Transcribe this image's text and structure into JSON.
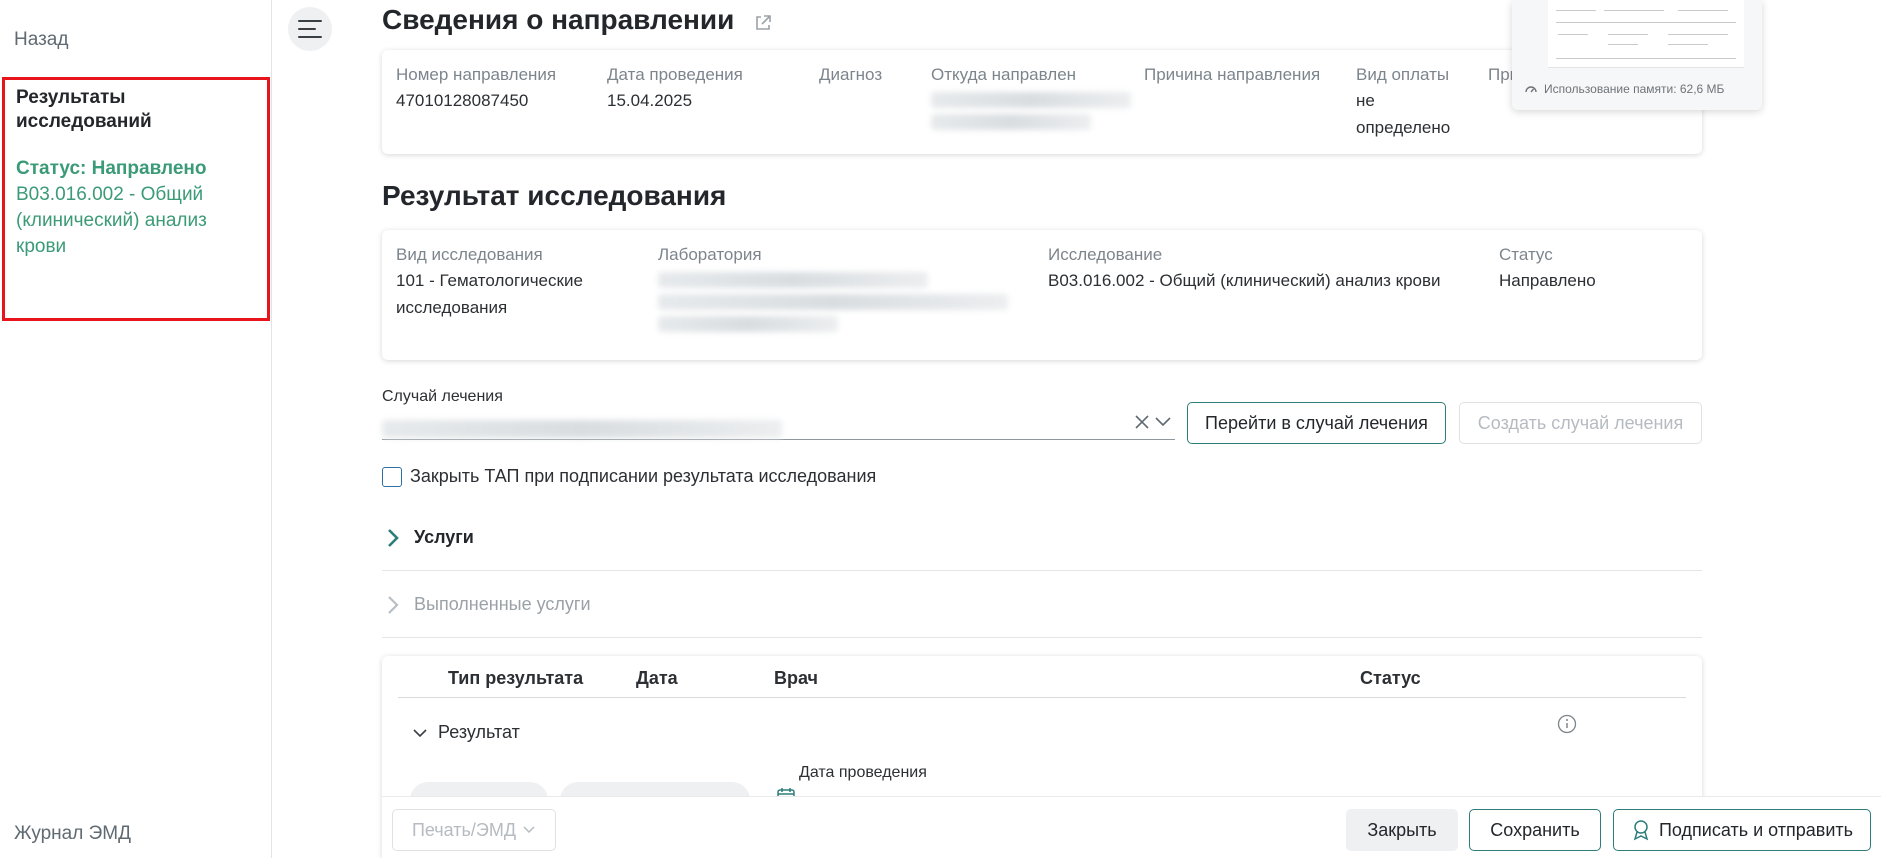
{
  "sidebar": {
    "back": "Назад",
    "results_title": "Результаты исследований",
    "status": "Статус: Направлено",
    "research_name": "B03.016.002 - Общий (клинический) анализ крови",
    "journal": "Журнал ЭМД"
  },
  "referral": {
    "title": "Сведения о направлении",
    "fields": {
      "number_label": "Номер направления",
      "number_value": "47010128087450",
      "date_label": "Дата проведения",
      "date_value": "15.04.2025",
      "diagnosis_label": "Диагноз",
      "from_label": "Откуда направлен",
      "reason_label": "Причина направления",
      "payment_label": "Вид оплаты",
      "payment_value": "не определено",
      "note_label": "Примечание"
    }
  },
  "memory": {
    "text": "Использование памяти: 62,6 МБ"
  },
  "result": {
    "title": "Результат исследования",
    "type_label": "Вид исследования",
    "type_value": "101 - Гематологические исследования",
    "lab_label": "Лаборатория",
    "research_label": "Исследование",
    "research_value": "B03.016.002 - Общий (клинический) анализ крови",
    "status_label": "Статус",
    "status_value": "Направлено"
  },
  "case": {
    "label": "Случай лечения",
    "goto_button": "Перейти в случай лечения",
    "create_button": "Создать случай лечения"
  },
  "checkbox": {
    "label": "Закрыть ТАП при подписании результата исследования"
  },
  "sections": {
    "services": "Услуги",
    "done_services": "Выполненные услуги"
  },
  "table": {
    "col_type": "Тип результата",
    "col_date": "Дата",
    "col_doctor": "Врач",
    "col_status": "Статус",
    "row_label": "Результат",
    "date_field_label": "Дата проведения"
  },
  "bottom": {
    "print_button": "Печать/ЭМД",
    "close_button": "Закрыть",
    "save_button": "Сохранить",
    "sign_button": "Подписать и отправить"
  },
  "colors": {
    "accent": "#2d7d7a",
    "status_green": "#3b9a78",
    "highlight_red": "#e8141b"
  }
}
